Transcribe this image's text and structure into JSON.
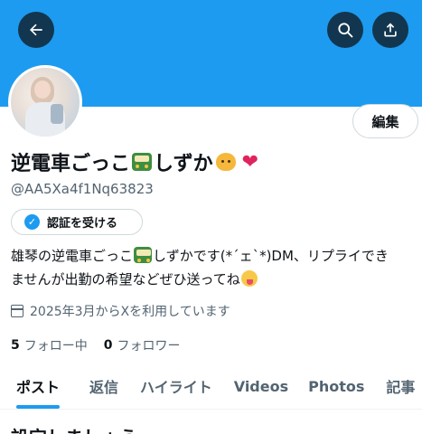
{
  "colors": {
    "banner": "#1d9bf0",
    "accent": "#1d9bf0",
    "secondary_text": "#536471"
  },
  "header": {
    "back_icon": "arrow-left-icon",
    "search_icon": "search-icon",
    "share_icon": "share-upload-icon"
  },
  "profile": {
    "edit_label": "編集",
    "display_name_text_1": "逆電車ごっこ",
    "display_name_text_2": "しずか",
    "display_name_emojis": [
      "tram-icon",
      "cat-face-icon",
      "red-heart-icon"
    ],
    "handle": "@AA5Xa4f1Nq63823",
    "verify_label": "認証を受ける",
    "bio_line1_a": "雄琴の逆電車ごっこ",
    "bio_line1_b": "しずかです(*´ェ`*)DM、リプライでき",
    "bio_line2": "ませんが出勤の希望などぜひ送ってね",
    "joined": "2025年3月からXを利用しています",
    "following_count": "5",
    "following_label": "フォロー中",
    "followers_count": "0",
    "followers_label": "フォロワー"
  },
  "tabs": [
    {
      "label": "ポスト",
      "active": true
    },
    {
      "label": "返信",
      "active": false
    },
    {
      "label": "ハイライト",
      "active": false
    },
    {
      "label": "Videos",
      "active": false
    },
    {
      "label": "Photos",
      "active": false
    },
    {
      "label": "記事",
      "active": false
    }
  ],
  "next_section_heading": "設定しましょう"
}
